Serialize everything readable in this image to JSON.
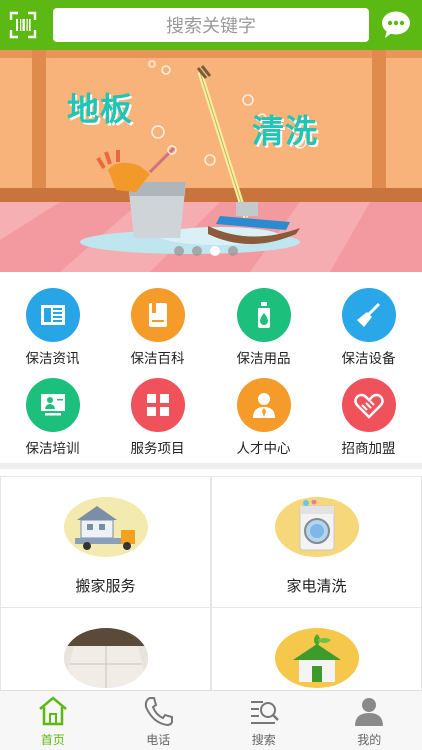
{
  "header": {
    "search_placeholder": "搜索关键字",
    "scan_icon": "scan-icon",
    "chat_icon": "chat-bubble-icon",
    "bg_color": "#5cb812"
  },
  "banner": {
    "title_left": "地板",
    "title_right": "清洗",
    "slide_count": 4,
    "active_slide": 3
  },
  "categories": [
    {
      "label": "保洁资讯",
      "icon": "news-icon",
      "color": "#28a5e6"
    },
    {
      "label": "保洁百科",
      "icon": "book-icon",
      "color": "#f49b2a"
    },
    {
      "label": "保洁用品",
      "icon": "cleaning-bottle-icon",
      "color": "#1dbf7d"
    },
    {
      "label": "保洁设备",
      "icon": "broom-icon",
      "color": "#2aa7e8"
    },
    {
      "label": "保洁培训",
      "icon": "training-board-icon",
      "color": "#1dbf7d"
    },
    {
      "label": "服务项目",
      "icon": "grid-icon",
      "color": "#f0525c"
    },
    {
      "label": "人才中心",
      "icon": "person-icon",
      "color": "#f49b2a"
    },
    {
      "label": "招商加盟",
      "icon": "handshake-icon",
      "color": "#f0525c"
    }
  ],
  "services": [
    {
      "label": "搬家服务",
      "icon": "moving-truck-icon"
    },
    {
      "label": "家电清洗",
      "icon": "washing-machine-icon"
    },
    {
      "label": "",
      "icon": "floor-tile-icon"
    },
    {
      "label": "",
      "icon": "green-house-icon"
    }
  ],
  "tabbar": {
    "items": [
      {
        "label": "首页",
        "icon": "home-icon",
        "active": true
      },
      {
        "label": "电话",
        "icon": "phone-icon",
        "active": false
      },
      {
        "label": "搜索",
        "icon": "search-list-icon",
        "active": false
      },
      {
        "label": "我的",
        "icon": "user-icon",
        "active": false
      }
    ],
    "active_color": "#5cb812"
  }
}
